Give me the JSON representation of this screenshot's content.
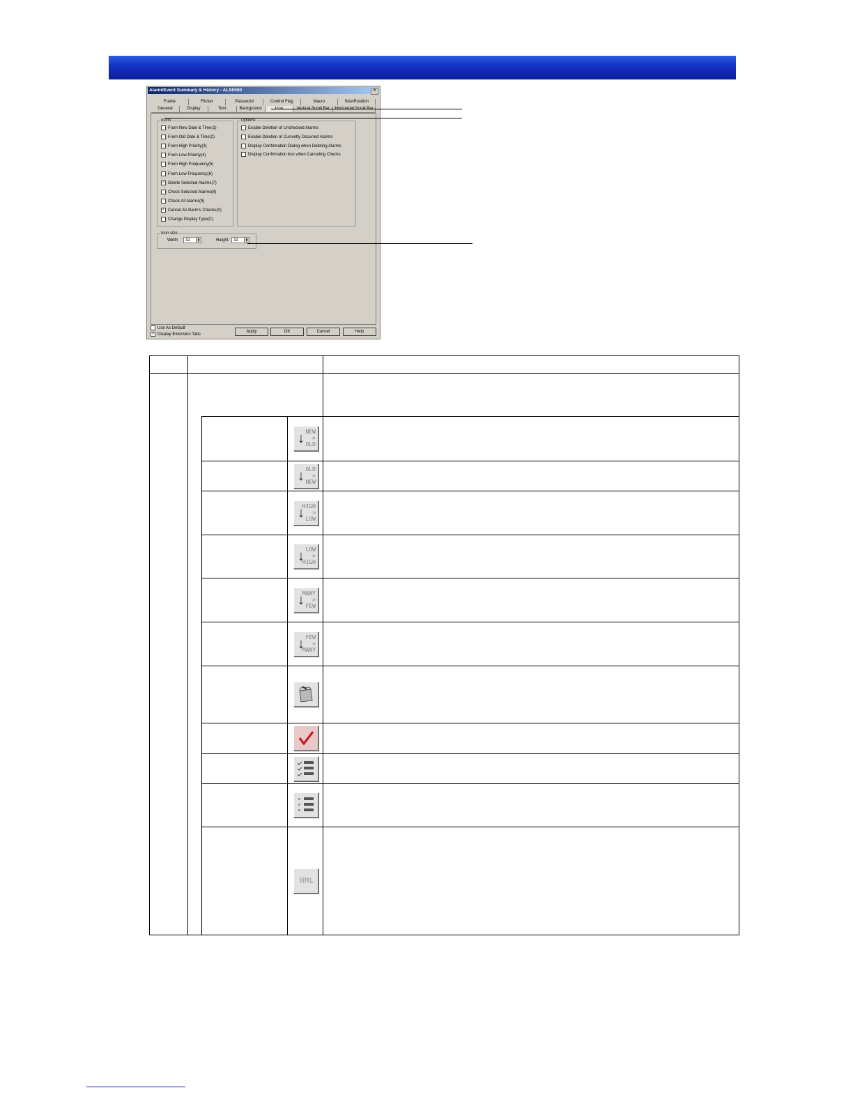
{
  "dialog": {
    "title": "Alarm/Event Summary & History - ALS0000",
    "close": "×",
    "tabs_row1": [
      "Frame",
      "Flicker",
      "Password",
      "Control Flag",
      "Macro",
      "Size/Position"
    ],
    "tabs_row2": [
      "General",
      "Display",
      "Text",
      "Background",
      "Icon",
      "Vertical Scroll Bar",
      "Horizontal Scroll Bar"
    ],
    "active_tab": "Icon",
    "icons_group": {
      "legend": "Icons",
      "items": [
        {
          "label": "From New Date & Time(1)",
          "checked": false
        },
        {
          "label": "From Old Date & Time(2)",
          "checked": false
        },
        {
          "label": "From High Priority(3)",
          "checked": false
        },
        {
          "label": "From Low Priority(4)",
          "checked": false
        },
        {
          "label": "From High Frequency(5)",
          "checked": false
        },
        {
          "label": "From Low Frequency(6)",
          "checked": false
        },
        {
          "label": "Delete Selected Alarms(7)",
          "checked": true
        },
        {
          "label": "Check Selected Alarms(8)",
          "checked": false
        },
        {
          "label": "Check All Alarms(9)",
          "checked": false
        },
        {
          "label": "Cancel All Alarm's Checks(0)",
          "checked": true
        },
        {
          "label": "Change Display Type(C)",
          "checked": false
        }
      ]
    },
    "options_group": {
      "legend": "Options",
      "items": [
        {
          "label": "Enable Deletion of Unchecked Alarms",
          "checked": false
        },
        {
          "label": "Enable Deletion of Currently Occurred Alarms",
          "checked": false
        },
        {
          "label": "Display Confirmation Dialog when Deleting Alarms",
          "checked": false
        },
        {
          "label": "Display Confirmation box when Canceling Checks",
          "checked": false
        }
      ]
    },
    "icon_size": {
      "legend": "Icon size",
      "width_label": "Width",
      "width_value": "32",
      "height_label": "Height",
      "height_value": "32"
    },
    "bottom": {
      "use_as_default": "Use As Default",
      "use_as_default_checked": false,
      "display_extension_tabs": "Display Extension Tabs",
      "display_extension_tabs_checked": true,
      "apply": "Apply",
      "ok": "OK",
      "cancel": "Cancel",
      "help": "Help"
    }
  },
  "table": {
    "icon_rows": [
      {
        "icon": "sort-new-old-icon",
        "text": "NEW\n>\nOLD"
      },
      {
        "icon": "sort-old-new-icon",
        "text": "OLD\n>\nNEW"
      },
      {
        "icon": "sort-high-low-icon",
        "text": "HIGH\n>\nLOW"
      },
      {
        "icon": "sort-low-high-icon",
        "text": "LOW\n>\nHIGH"
      },
      {
        "icon": "sort-many-few-icon",
        "text": "MANY\n>\nFEW"
      },
      {
        "icon": "sort-few-many-icon",
        "text": "FEW\n>\nMANY"
      },
      {
        "icon": "delete-alarms-icon",
        "text": ""
      },
      {
        "icon": "check-selected-icon",
        "text": ""
      },
      {
        "icon": "check-all-icon",
        "text": ""
      },
      {
        "icon": "cancel-checks-icon",
        "text": ""
      },
      {
        "icon": "hml-display-type-icon",
        "text": "HML"
      }
    ]
  },
  "colors": {
    "banner": "#1230c4",
    "dialog_face": "#d4d0c8",
    "titlebar": "#0a246a",
    "check_red": "#cc1111"
  }
}
